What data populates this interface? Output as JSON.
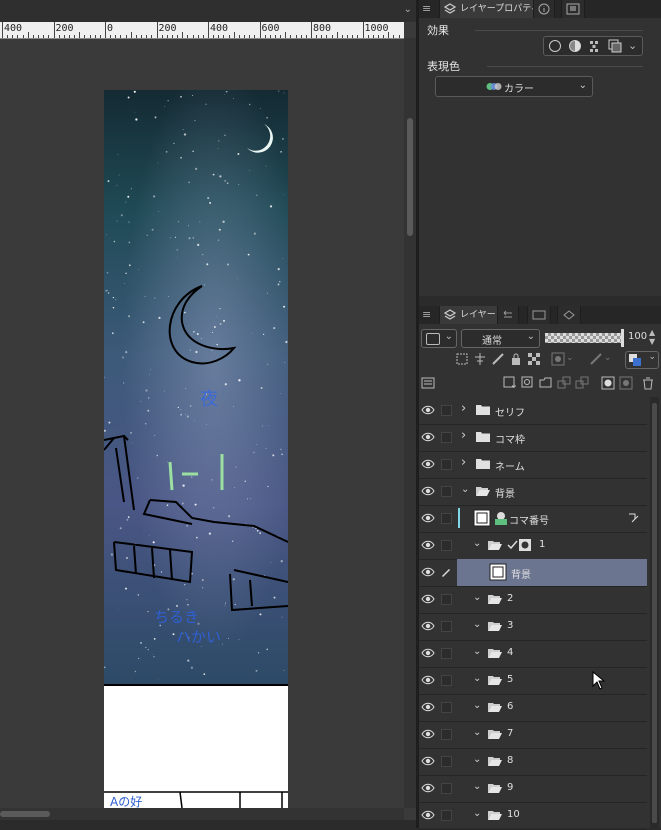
{
  "ruler": {
    "labels": [
      "400",
      "200",
      "0",
      "200",
      "400",
      "600",
      "800",
      "1000"
    ]
  },
  "properties_panel": {
    "tab_label": "レイヤープロパティ",
    "effect_label": "効果",
    "expression_color_label": "表現色",
    "expression_color_value": "カラー"
  },
  "layer_panel": {
    "tab_label": "レイヤー",
    "blend_mode": "通常",
    "opacity": "100",
    "layers": [
      {
        "name": "セリフ",
        "type": "folder",
        "expanded": false,
        "indent": 0
      },
      {
        "name": "コマ枠",
        "type": "folder",
        "expanded": false,
        "indent": 0
      },
      {
        "name": "ネーム",
        "type": "folder",
        "expanded": false,
        "indent": 0
      },
      {
        "name": "背景",
        "type": "folder",
        "expanded": true,
        "indent": 0
      },
      {
        "name": "コマ番号",
        "type": "layer",
        "indent": 0
      },
      {
        "name": "1",
        "type": "folder",
        "expanded": true,
        "indent": 1
      },
      {
        "name": "背景",
        "type": "layer",
        "indent": 1,
        "selected": true
      },
      {
        "name": "2",
        "type": "folder",
        "expanded": true,
        "indent": 1
      },
      {
        "name": "3",
        "type": "folder",
        "expanded": true,
        "indent": 1
      },
      {
        "name": "4",
        "type": "folder",
        "expanded": true,
        "indent": 1
      },
      {
        "name": "5",
        "type": "folder",
        "expanded": true,
        "indent": 1
      },
      {
        "name": "6",
        "type": "folder",
        "expanded": true,
        "indent": 1
      },
      {
        "name": "7",
        "type": "folder",
        "expanded": true,
        "indent": 1
      },
      {
        "name": "8",
        "type": "folder",
        "expanded": true,
        "indent": 1
      },
      {
        "name": "9",
        "type": "folder",
        "expanded": true,
        "indent": 1
      },
      {
        "name": "10",
        "type": "folder",
        "expanded": true,
        "indent": 1
      }
    ]
  },
  "artwork": {
    "annotation_night": "夜",
    "annotation_stars": "ちるき\nハかい",
    "annotation_bottom": "Aの好"
  },
  "colors": {
    "selected_row": "#6b7590",
    "panel_bg": "#323232",
    "canvas_bg": "#3a3a3a"
  }
}
